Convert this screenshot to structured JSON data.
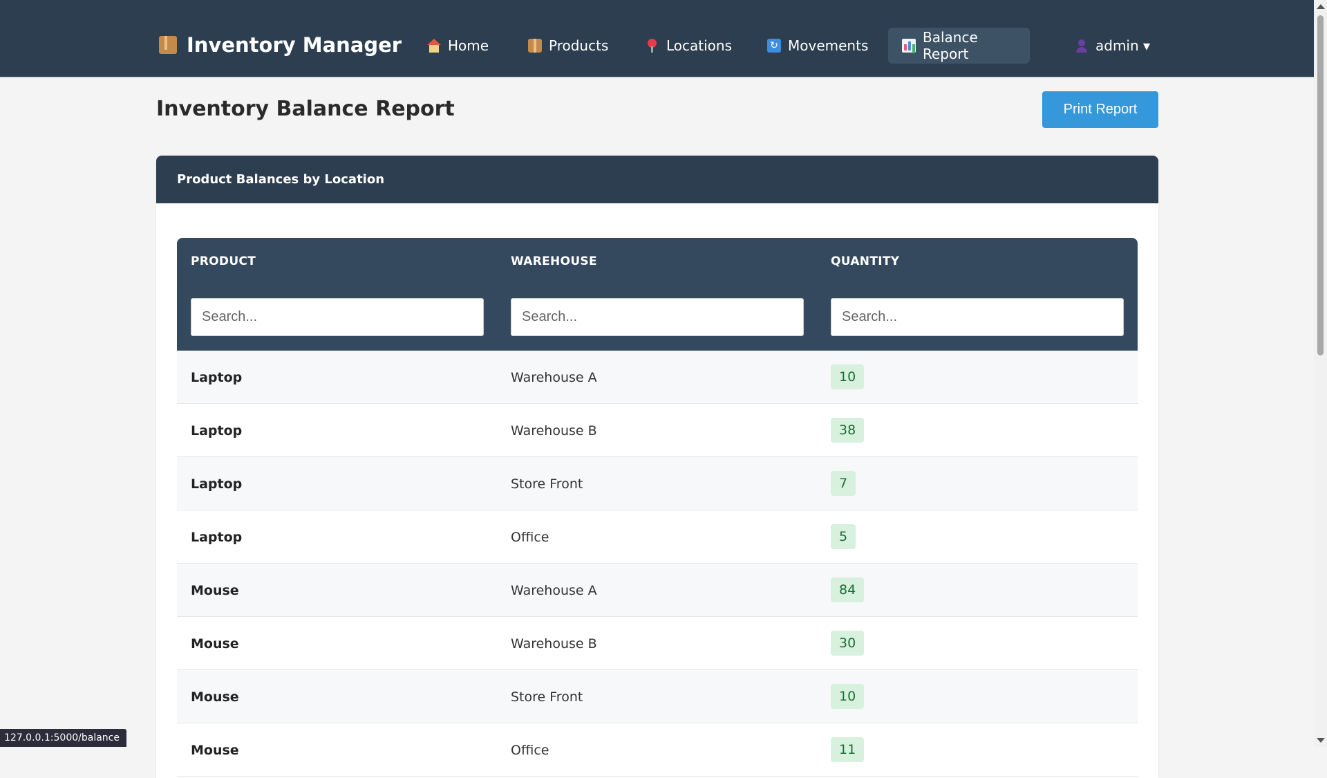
{
  "navbar": {
    "brand": "Inventory Manager",
    "items": [
      {
        "label": "Home",
        "icon": "home-icon"
      },
      {
        "label": "Products",
        "icon": "box-icon"
      },
      {
        "label": "Locations",
        "icon": "pin-icon"
      },
      {
        "label": "Movements",
        "icon": "refresh-icon"
      },
      {
        "label": "Balance Report",
        "icon": "chart-icon",
        "active": true
      }
    ],
    "user": "admin ▾"
  },
  "page": {
    "title": "Inventory Balance Report",
    "print_label": "Print Report"
  },
  "card": {
    "title": "Product Balances by Location"
  },
  "table": {
    "columns": [
      "PRODUCT",
      "WAREHOUSE",
      "QUANTITY"
    ],
    "search_placeholder": "Search...",
    "rows": [
      {
        "product": "Laptop",
        "warehouse": "Warehouse A",
        "quantity": "10"
      },
      {
        "product": "Laptop",
        "warehouse": "Warehouse B",
        "quantity": "38"
      },
      {
        "product": "Laptop",
        "warehouse": "Store Front",
        "quantity": "7"
      },
      {
        "product": "Laptop",
        "warehouse": "Office",
        "quantity": "5"
      },
      {
        "product": "Mouse",
        "warehouse": "Warehouse A",
        "quantity": "84"
      },
      {
        "product": "Mouse",
        "warehouse": "Warehouse B",
        "quantity": "30"
      },
      {
        "product": "Mouse",
        "warehouse": "Store Front",
        "quantity": "10"
      },
      {
        "product": "Mouse",
        "warehouse": "Office",
        "quantity": "11"
      }
    ]
  },
  "status_bar": {
    "url": "127.0.0.1:5000/balance"
  },
  "colors": {
    "navbar_bg": "#2c3e50",
    "accent": "#3498db",
    "qty_badge_bg": "#d8f0de",
    "qty_badge_text": "#1d6b33"
  }
}
